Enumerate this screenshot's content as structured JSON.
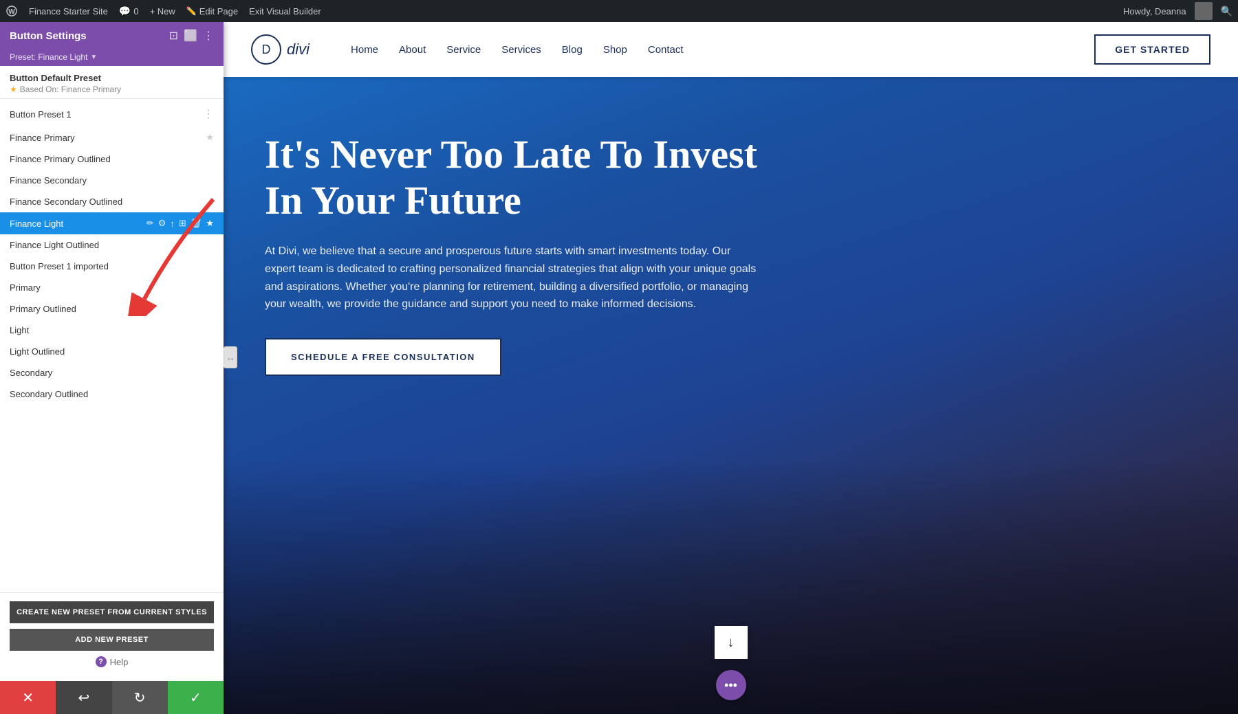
{
  "adminBar": {
    "wpIcon": "W",
    "siteName": "Finance Starter Site",
    "commentCount": "0",
    "newLabel": "+ New",
    "editPageLabel": "Edit Page",
    "exitBuilderLabel": "Exit Visual Builder",
    "howdyLabel": "Howdy, Deanna",
    "searchIcon": "🔍"
  },
  "panel": {
    "title": "Button Settings",
    "presetLabel": "Preset: Finance Light",
    "presetChevron": "▼",
    "defaultPreset": {
      "title": "Button Default Preset",
      "subtitle": "Based On: Finance Primary",
      "star": "★"
    },
    "presets": [
      {
        "name": "Button Preset 1",
        "active": false,
        "star": false,
        "dots": true
      },
      {
        "name": "Finance Primary",
        "active": false,
        "star": true,
        "dots": false
      },
      {
        "name": "Finance Primary Outlined",
        "active": false,
        "star": false,
        "dots": false
      },
      {
        "name": "Finance Secondary",
        "active": false,
        "star": false,
        "dots": false
      },
      {
        "name": "Finance Secondary Outlined",
        "active": false,
        "star": false,
        "dots": false
      },
      {
        "name": "Finance Light",
        "active": true,
        "star": true,
        "dots": false
      },
      {
        "name": "Finance Light Outlined",
        "active": false,
        "star": false,
        "dots": false
      },
      {
        "name": "Button Preset 1 imported",
        "active": false,
        "star": false,
        "dots": false
      },
      {
        "name": "Primary",
        "active": false,
        "star": false,
        "dots": false
      },
      {
        "name": "Primary Outlined",
        "active": false,
        "star": false,
        "dots": false
      },
      {
        "name": "Light",
        "active": false,
        "star": false,
        "dots": false
      },
      {
        "name": "Light Outlined",
        "active": false,
        "star": false,
        "dots": false
      },
      {
        "name": "Secondary",
        "active": false,
        "star": false,
        "dots": false
      },
      {
        "name": "Secondary Outlined",
        "active": false,
        "star": false,
        "dots": false
      }
    ],
    "activeActions": [
      "✏",
      "⚙",
      "↑",
      "⊞",
      "🗑",
      "★"
    ],
    "createPresetLabel": "CREATE NEW PRESET FROM CURRENT STYLES",
    "addPresetLabel": "ADD NEW PRESET",
    "helpLabel": "Help"
  },
  "bottomToolbar": {
    "closeLabel": "✕",
    "undoLabel": "↩",
    "redoLabel": "↻",
    "saveLabel": "✓"
  },
  "siteNav": {
    "logoLetter": "D",
    "logoText": "divi",
    "links": [
      "Home",
      "About",
      "Service",
      "Services",
      "Blog",
      "Shop",
      "Contact"
    ],
    "ctaLabel": "GET STARTED"
  },
  "hero": {
    "title": "It's Never Too Late To Invest In Your Future",
    "body": "At Divi, we believe that a secure and prosperous future starts with smart investments today. Our expert team is dedicated to crafting personalized financial strategies that align with your unique goals and aspirations. Whether you're planning for retirement, building a diversified portfolio, or managing your wealth, we provide the guidance and support you need to make informed decisions.",
    "ctaLabel": "SCHEDULE A FREE CONSULTATION"
  }
}
